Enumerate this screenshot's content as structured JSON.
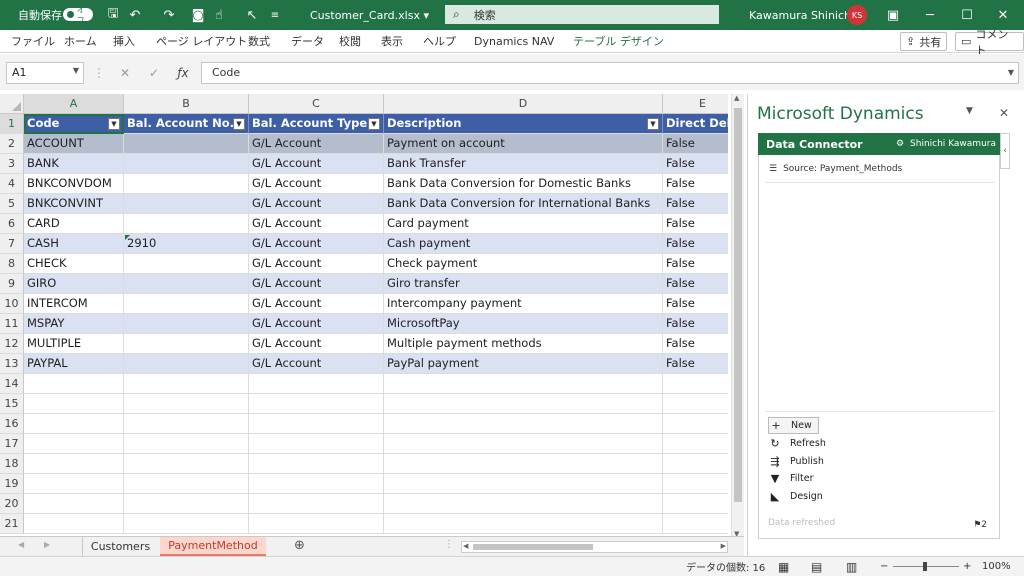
{
  "titlebar": {
    "autosave": "自動保存",
    "toggle": "オフ",
    "filename": "Customer_Card.xlsx",
    "filename_caret": "▾",
    "search": "検索",
    "user": "Kawamura Shinichi",
    "initials": "KS"
  },
  "ribbon": {
    "tabs": [
      "ファイル",
      "ホーム",
      "挿入",
      "ページ レイアウト",
      "数式",
      "データ",
      "校閲",
      "表示",
      "ヘルプ",
      "Dynamics NAV",
      "テーブル デザイン"
    ],
    "share": "共有",
    "comment": "コメント"
  },
  "formula": {
    "namebox": "A1",
    "value": "Code"
  },
  "columns": [
    "A",
    "B",
    "C",
    "D",
    "E"
  ],
  "header": [
    "Code",
    "Bal. Account No.",
    "Bal. Account Type",
    "Description",
    "Direct Debit"
  ],
  "rows": [
    [
      "ACCOUNT",
      "",
      "G/L Account",
      "Payment on account",
      "False"
    ],
    [
      "BANK",
      "",
      "G/L Account",
      "Bank Transfer",
      "False"
    ],
    [
      "BNKCONVDOM",
      "",
      "G/L Account",
      "Bank Data Conversion for Domestic Banks",
      "False"
    ],
    [
      "BNKCONVINT",
      "",
      "G/L Account",
      "Bank Data Conversion for International Banks",
      "False"
    ],
    [
      "CARD",
      "",
      "G/L Account",
      "Card payment",
      "False"
    ],
    [
      "CASH",
      "2910",
      "G/L Account",
      "Cash payment",
      "False"
    ],
    [
      "CHECK",
      "",
      "G/L Account",
      "Check payment",
      "False"
    ],
    [
      "GIRO",
      "",
      "G/L Account",
      "Giro transfer",
      "False"
    ],
    [
      "INTERCOM",
      "",
      "G/L Account",
      "Intercompany payment",
      "False"
    ],
    [
      "MSPAY",
      "",
      "G/L Account",
      "MicrosoftPay",
      "False"
    ],
    [
      "MULTIPLE",
      "",
      "G/L Account",
      "Multiple payment methods",
      "False"
    ],
    [
      "PAYPAL",
      "",
      "G/L Account",
      "PayPal payment",
      "False"
    ]
  ],
  "row_numbers": [
    "1",
    "2",
    "3",
    "4",
    "5",
    "6",
    "7",
    "8",
    "9",
    "10",
    "11",
    "12",
    "13",
    "14",
    "15",
    "16",
    "17",
    "18",
    "19",
    "20",
    "21"
  ],
  "sheets": [
    "Customers",
    "PaymentMethod"
  ],
  "status": {
    "count": "データの個数: 16",
    "zoom": "100%"
  },
  "pane": {
    "title": "Microsoft Dynamics",
    "header": "Data Connector",
    "user": "Shinichi Kawamura",
    "source": "Source: Payment_Methods",
    "actions": [
      "New",
      "Refresh",
      "Publish",
      "Filter",
      "Design"
    ],
    "refreshed": "Data refreshed",
    "flag": "2"
  }
}
